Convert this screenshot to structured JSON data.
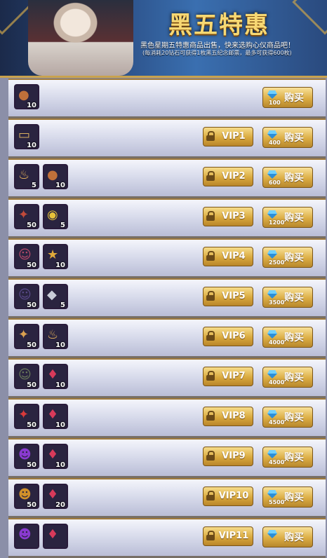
{
  "banner": {
    "title": "黑五特惠",
    "subtitle": "黑色星期五特惠商品出售，快来选购心仪商品吧！",
    "note": "(每消耗20钻石可获得1枚黑五纪念邮票，最多可获得600枚)"
  },
  "rows": [
    {
      "items": [
        {
          "icon": "copper-orb-icon",
          "color": "#c0703a",
          "qty": "10"
        }
      ],
      "vip": "",
      "price": "100",
      "buy": "购买"
    },
    {
      "items": [
        {
          "icon": "gold-ticket-icon",
          "color": "#d9b060",
          "qty": "10"
        }
      ],
      "vip": "VIP1",
      "price": "400",
      "buy": "购买"
    },
    {
      "items": [
        {
          "icon": "beer-mug-icon",
          "color": "#e8b45a",
          "qty": "5"
        },
        {
          "icon": "copper-orb-icon",
          "color": "#c0703a",
          "qty": "10"
        }
      ],
      "vip": "VIP2",
      "price": "600",
      "buy": "购买"
    },
    {
      "items": [
        {
          "icon": "hero-fragment-icon",
          "color": "#c04a3a",
          "qty": "50"
        },
        {
          "icon": "gold-coin-icon",
          "color": "#e6c23a",
          "qty": "5"
        }
      ],
      "vip": "VIP3",
      "price": "1200",
      "buy": "购买"
    },
    {
      "items": [
        {
          "icon": "hero-portrait-icon",
          "color": "#b84a6a",
          "qty": "50"
        },
        {
          "icon": "star-badge-icon",
          "color": "#e0a93a",
          "qty": "10"
        }
      ],
      "vip": "VIP4",
      "price": "2500",
      "buy": "购买"
    },
    {
      "items": [
        {
          "icon": "hero-portrait-icon",
          "color": "#5a4a8a",
          "qty": "50"
        },
        {
          "icon": "silver-crystal-icon",
          "color": "#c8ccd8",
          "qty": "5"
        }
      ],
      "vip": "VIP5",
      "price": "3500",
      "buy": "购买"
    },
    {
      "items": [
        {
          "icon": "hero-fragment-icon",
          "color": "#d9a050",
          "qty": "50"
        },
        {
          "icon": "beer-mug-icon",
          "color": "#e8b45a",
          "qty": "10"
        }
      ],
      "vip": "VIP6",
      "price": "4000",
      "buy": "购买"
    },
    {
      "items": [
        {
          "icon": "hero-portrait-icon",
          "color": "#6a7a5a",
          "qty": "50"
        },
        {
          "icon": "red-gem-icon",
          "color": "#d83a5a",
          "qty": "10"
        }
      ],
      "vip": "VIP7",
      "price": "4000",
      "buy": "购买"
    },
    {
      "items": [
        {
          "icon": "hero-fragment-icon",
          "color": "#d83a3a",
          "qty": "50"
        },
        {
          "icon": "red-gem-icon",
          "color": "#d83a5a",
          "qty": "10"
        }
      ],
      "vip": "VIP8",
      "price": "4500",
      "buy": "购买"
    },
    {
      "items": [
        {
          "icon": "mystery-hero-icon",
          "color": "#8a3ad0",
          "qty": "50"
        },
        {
          "icon": "red-gem-icon",
          "color": "#d83a5a",
          "qty": "10"
        }
      ],
      "vip": "VIP9",
      "price": "4500",
      "buy": "购买"
    },
    {
      "items": [
        {
          "icon": "mystery-hero-icon",
          "color": "#d0902a",
          "qty": "50"
        },
        {
          "icon": "red-gem-icon",
          "color": "#d83a5a",
          "qty": "20"
        }
      ],
      "vip": "VIP10",
      "price": "5500",
      "buy": "购买"
    },
    {
      "items": [
        {
          "icon": "mystery-hero-icon",
          "color": "#8a3ad0",
          "qty": ""
        },
        {
          "icon": "red-gem-icon",
          "color": "#d83a5a",
          "qty": ""
        }
      ],
      "vip": "VIP11",
      "price": "",
      "buy": "购买"
    }
  ]
}
